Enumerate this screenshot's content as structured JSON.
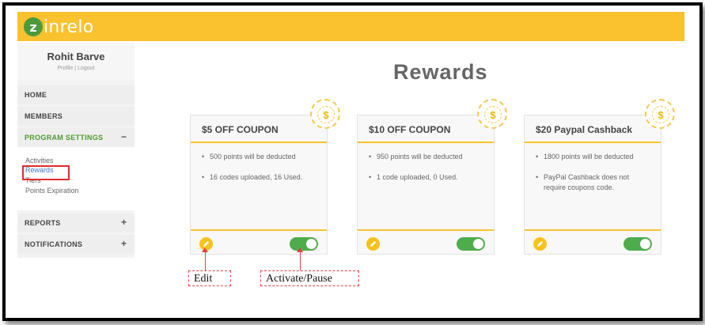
{
  "app": {
    "logo_letter": "z",
    "logo_text": "inrelo",
    "brand_color": "#f9c22e"
  },
  "user": {
    "name": "Rohit Barve",
    "links": "Profile | Logout"
  },
  "sidebar": {
    "items": [
      {
        "label": "HOME",
        "sign": ""
      },
      {
        "label": "MEMBERS",
        "sign": ""
      },
      {
        "label": "PROGRAM SETTINGS",
        "sign": "−"
      },
      {
        "label": "REPORTS",
        "sign": "+"
      },
      {
        "label": "NOTIFICATIONS",
        "sign": "+"
      }
    ],
    "sub_items": [
      "Activities",
      "Rewards",
      "Tiers",
      "Points Expiration"
    ]
  },
  "main": {
    "title": "Rewards",
    "cards": [
      {
        "title": "$5 OFF COUPON",
        "bullets": [
          "500 points will be deducted",
          "16 codes uploaded, 16 Used."
        ],
        "active": true
      },
      {
        "title": "$10 OFF COUPON",
        "bullets": [
          "950 points will be deducted",
          "1 code uploaded, 0 Used."
        ],
        "active": true
      },
      {
        "title": "$20 Paypal Cashback",
        "bullets": [
          "1800 points will be deducted",
          "PayPal Cashback does not require coupons code."
        ],
        "active": true
      }
    ],
    "coin_symbol": "$"
  },
  "annotations": {
    "edit": "Edit",
    "toggle": "Activate/Pause"
  }
}
